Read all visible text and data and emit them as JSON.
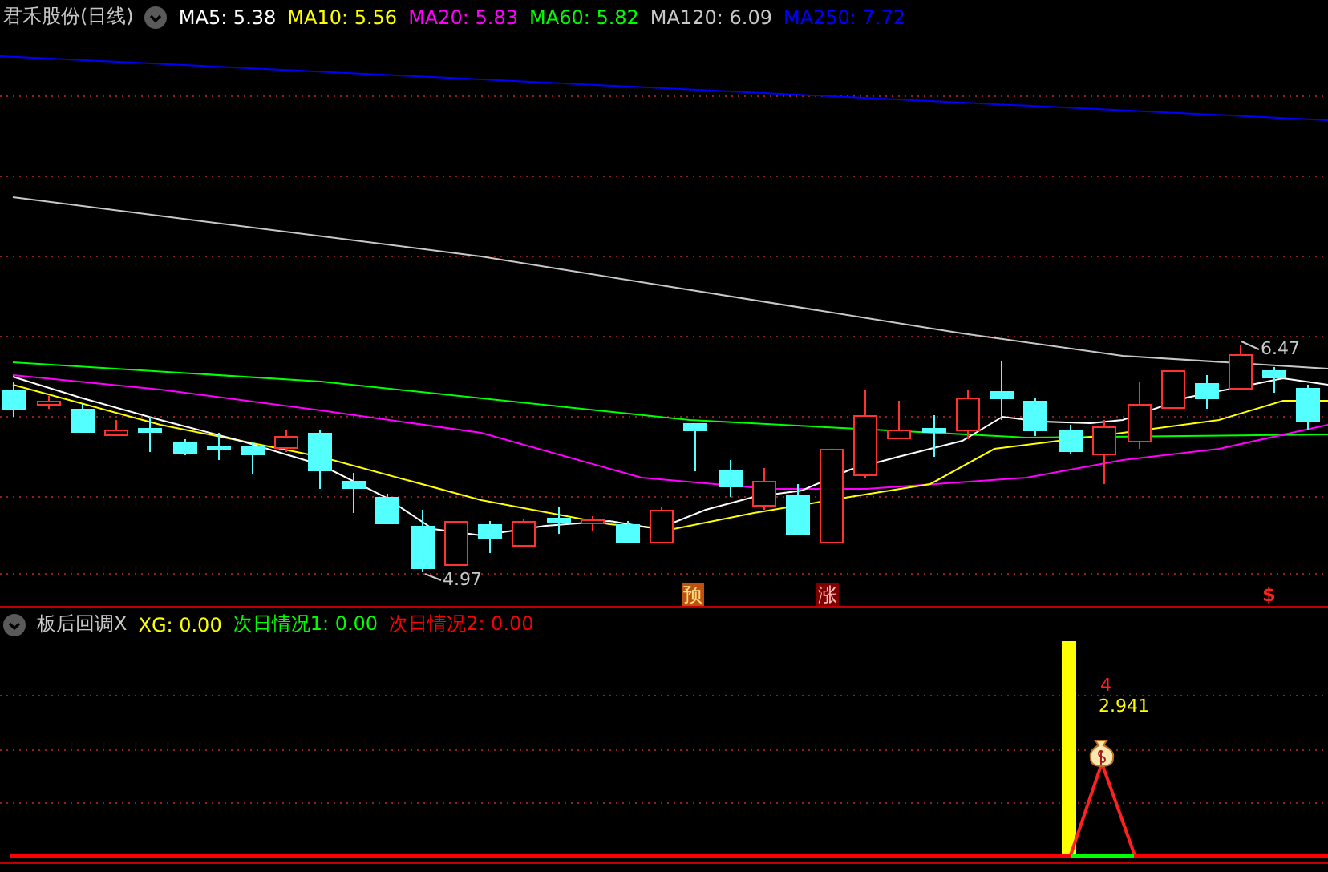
{
  "main_panel": {
    "title": "君禾股份(日线)",
    "indicators": [
      {
        "label": "MA5: 5.38",
        "color": "#ffffff"
      },
      {
        "label": "MA10: 5.56",
        "color": "#ffff00"
      },
      {
        "label": "MA20: 5.83",
        "color": "#ff00ff"
      },
      {
        "label": "MA60: 5.82",
        "color": "#00ff00"
      },
      {
        "label": "MA120: 6.09",
        "color": "#c8c8c8"
      },
      {
        "label": "MA250: 7.72",
        "color": "#0000ff"
      }
    ],
    "price_labels": [
      {
        "text": "4.97",
        "kind": "low"
      },
      {
        "text": "6.47",
        "kind": "high"
      }
    ],
    "signals": [
      {
        "text": "预",
        "kind": "orange_box"
      },
      {
        "text": "涨",
        "kind": "red_box"
      },
      {
        "text": "$",
        "kind": "plain"
      }
    ]
  },
  "sub_panel": {
    "title": "板后回调X",
    "indicators": [
      {
        "label": "XG: 0.00",
        "color": "#ffff00"
      },
      {
        "label": "次日情况1: 0.00",
        "color": "#00ff00"
      },
      {
        "label": "次日情况2: 0.00",
        "color": "#ff0000"
      }
    ],
    "labels": [
      {
        "text": "4",
        "color": "#ff2020"
      },
      {
        "text": "2.941",
        "color": "#ffff00"
      }
    ]
  }
}
